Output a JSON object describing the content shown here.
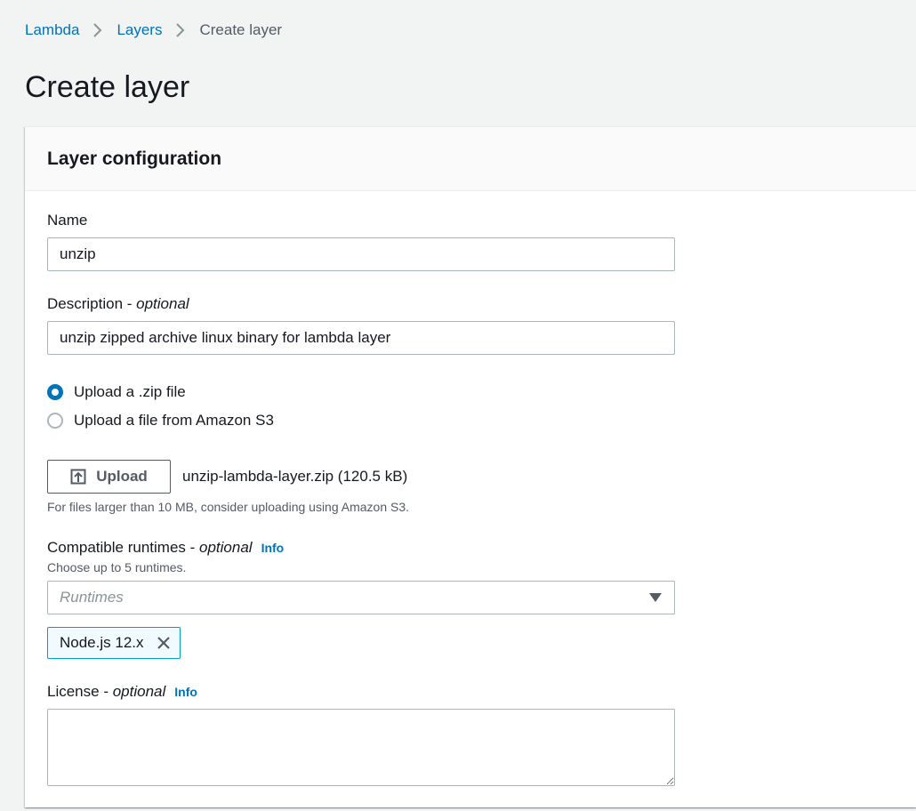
{
  "breadcrumb": {
    "items": [
      {
        "label": "Lambda"
      },
      {
        "label": "Layers"
      },
      {
        "label": "Create layer"
      }
    ]
  },
  "page": {
    "title": "Create layer"
  },
  "panel": {
    "title": "Layer configuration",
    "name": {
      "label": "Name",
      "value": "unzip"
    },
    "description": {
      "label": "Description - ",
      "optional": "optional",
      "value": "unzip zipped archive linux binary for lambda layer"
    },
    "upload_options": [
      {
        "label": "Upload a .zip file",
        "checked": true
      },
      {
        "label": "Upload a file from Amazon S3",
        "checked": false
      }
    ],
    "upload": {
      "button_label": "Upload",
      "file_name": "unzip-lambda-layer.zip (120.5 kB)",
      "hint": "For files larger than 10 MB, consider uploading using Amazon S3."
    },
    "runtimes": {
      "label": "Compatible runtimes - ",
      "optional": "optional",
      "info": "Info",
      "hint": "Choose up to 5 runtimes.",
      "placeholder": "Runtimes",
      "selected": [
        "Node.js 12.x"
      ]
    },
    "license": {
      "label": "License - ",
      "optional": "optional",
      "info": "Info",
      "value": ""
    }
  },
  "icons": {
    "breadcrumb_separator": "chevron-right-icon",
    "upload": "upload-icon",
    "dropdown": "caret-down-icon",
    "token_dismiss": "close-icon"
  },
  "colors": {
    "link": "#0073bb",
    "radio_selected": "#0073bb",
    "token_border": "#00a1c9",
    "token_background": "#f1faff"
  }
}
